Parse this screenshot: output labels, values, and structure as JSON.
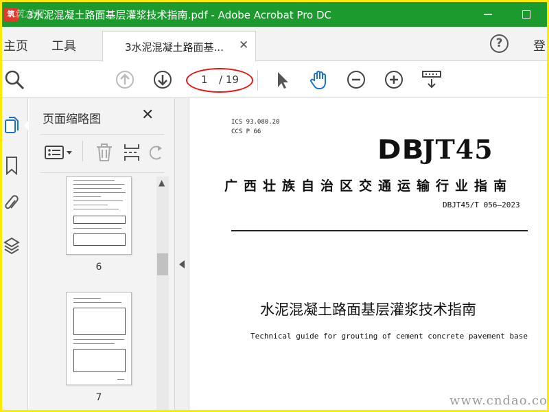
{
  "window": {
    "title": "3水泥混凝土路面基层灌浆技术指南.pdf - Adobe Acrobat Pro DC",
    "app_logo_text": "筑",
    "app_logo_watermark": "筑龙网"
  },
  "menu": {
    "home": "主页",
    "tools": "工具",
    "tab_label": "3水泥混凝土路面基...",
    "help": "?",
    "login": "登"
  },
  "toolbar": {
    "current_page": "1",
    "total_pages": "/ 19"
  },
  "panel": {
    "title": "页面缩略图",
    "thumbnails": [
      {
        "label": "6"
      },
      {
        "label": "7"
      }
    ]
  },
  "document": {
    "ics_line": "ICS  93.080.20",
    "ccs_line": "CCS  P  66",
    "logo_db": "DB",
    "logo_rest": "JT45",
    "org": "广西壮族自治区交通运输行业指南",
    "std_number": "DBJT45/T 056—2023",
    "title_cn": "水泥混凝土路面基层灌浆技术指南",
    "title_en": "Technical guide for grouting of cement concrete pavement base"
  },
  "watermark": "www.cndao.com",
  "colors": {
    "titlebar": "#1d9a2e",
    "frame_border": "#ffeb00",
    "annotation": "#ee1111",
    "hand_tool": "#1a73c8"
  }
}
